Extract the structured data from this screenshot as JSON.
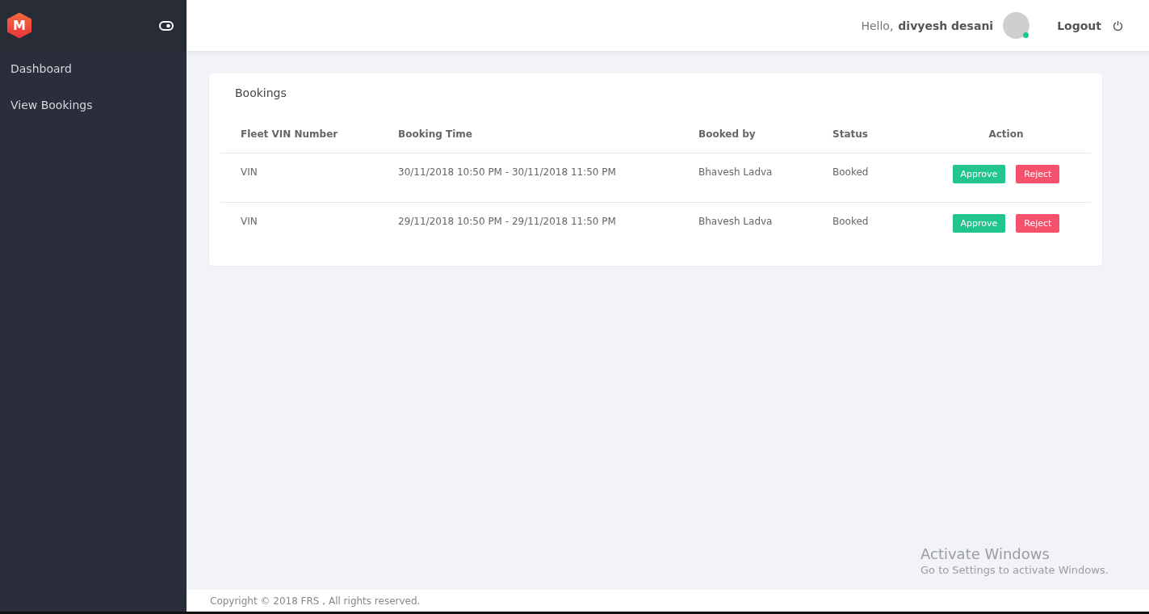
{
  "brand": {
    "letter": "M"
  },
  "sidebar": {
    "items": [
      {
        "label": "Dashboard",
        "selected": false
      },
      {
        "label": "View Bookings",
        "selected": false
      }
    ]
  },
  "topbar": {
    "greeting": "Hello,",
    "user_name": "divyesh desani",
    "online": true,
    "logout": "Logout"
  },
  "card": {
    "title": "Bookings",
    "table": {
      "columns": [
        "Fleet VIN Number",
        "Booking Time",
        "Booked by",
        "Status",
        "Action"
      ],
      "rows": [
        {
          "vin": "VIN",
          "time": "30/11/2018 10:50 PM - 30/11/2018 11:50 PM",
          "booked_by": "Bhavesh Ladva",
          "status": "Booked",
          "actions": [
            {
              "label": "Approve",
              "kind": "approve"
            },
            {
              "label": "Reject",
              "kind": "reject"
            }
          ]
        },
        {
          "vin": "VIN",
          "time": "29/11/2018 10:50 PM - 29/11/2018 11:50 PM",
          "booked_by": "Bhavesh Ladva",
          "status": "Booked",
          "actions": [
            {
              "label": "Approve",
              "kind": "approve"
            },
            {
              "label": "Reject",
              "kind": "reject"
            }
          ]
        }
      ]
    }
  },
  "footer": "Copyright © 2018 FRS , All rights reserved.",
  "os_notice": {
    "title": "Activate Windows",
    "text": "Go to Settings to activate Windows."
  }
}
